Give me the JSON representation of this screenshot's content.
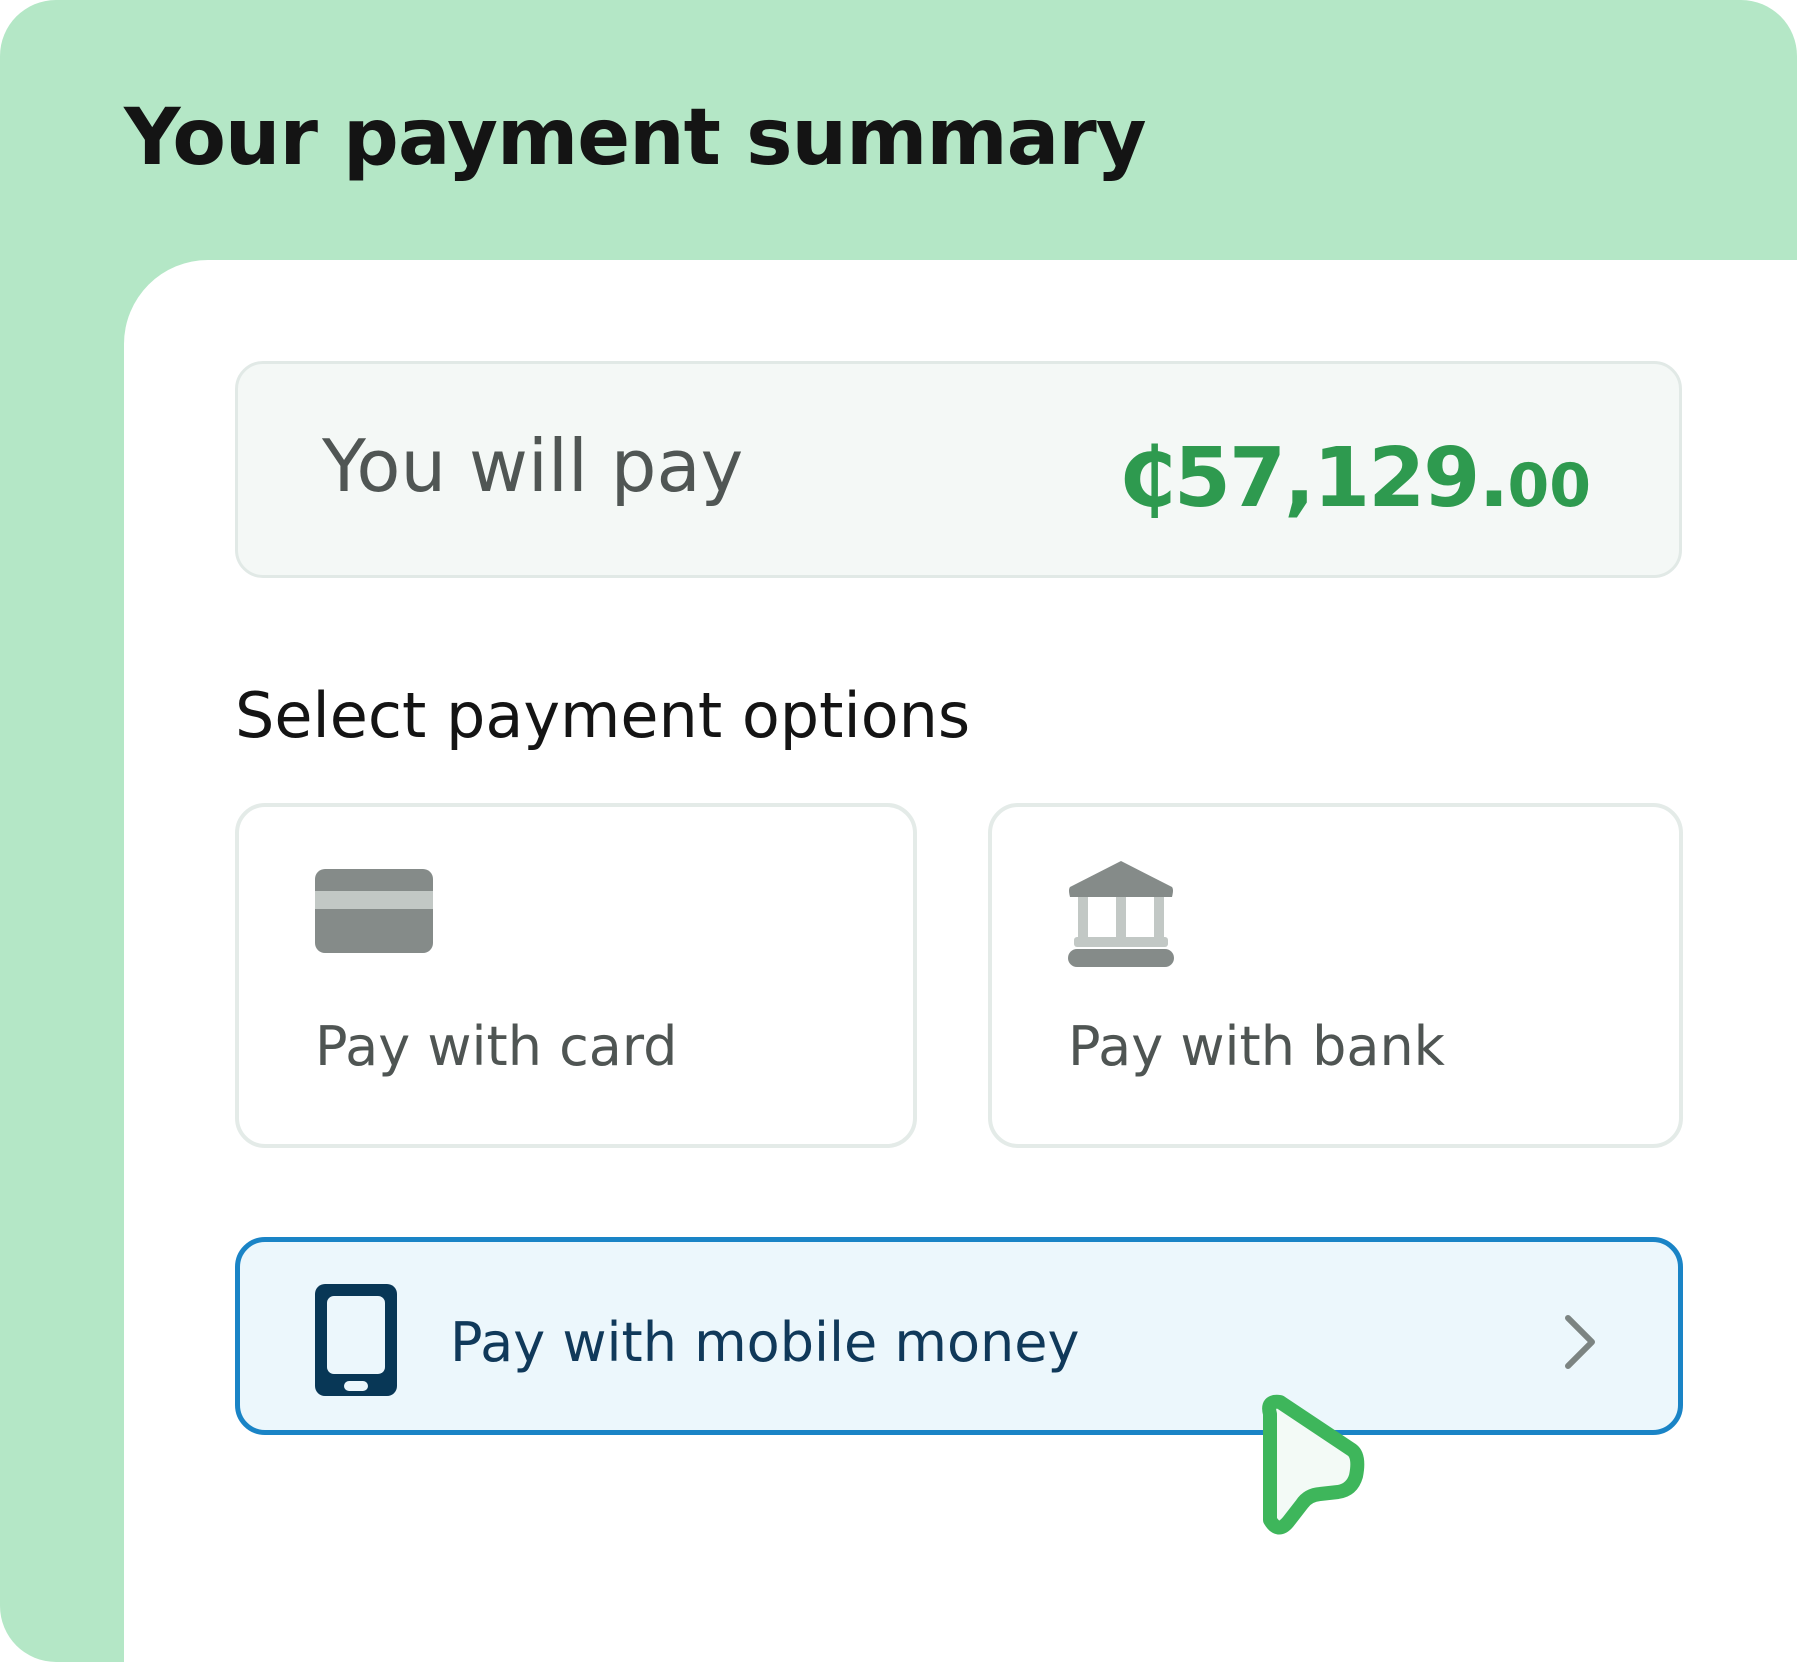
{
  "header": {
    "title": "Your payment summary"
  },
  "summary": {
    "label": "You will pay",
    "amount_main": "₵57,129.",
    "amount_cents": "00"
  },
  "payment_options": {
    "heading": "Select payment options",
    "card": {
      "label": "Pay with card",
      "icon": "credit-card-icon"
    },
    "bank": {
      "label": "Pay with bank",
      "icon": "bank-icon"
    },
    "mobile": {
      "label": "Pay with mobile money",
      "icon": "mobile-phone-icon",
      "selected": true
    }
  },
  "colors": {
    "header_background": "#b4e7c6",
    "amount": "#2e9a4f",
    "selected_border": "#1a84c6",
    "selected_background": "#ecf7fc",
    "cursor": "#3eb65b"
  }
}
